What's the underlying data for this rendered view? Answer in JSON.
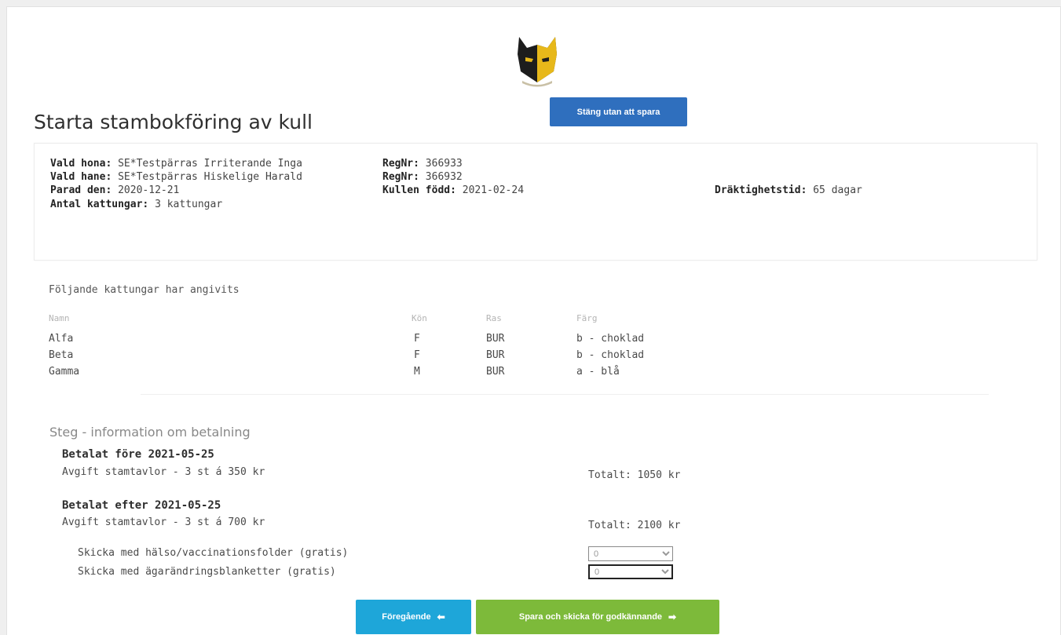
{
  "header": {
    "title": "Starta stambokföring av kull",
    "close_button": "Stäng utan att spara"
  },
  "litter": {
    "mother_label": "Vald hona:",
    "mother_value": "SE*Testpärras Irriterande Inga",
    "mother_reg_label": "RegNr:",
    "mother_reg_value": "366933",
    "father_label": "Vald hane:",
    "father_value": "SE*Testpärras Hiskelige Harald",
    "father_reg_label": "RegNr:",
    "father_reg_value": "366932",
    "mated_label": "Parad den:",
    "mated_value": "2020-12-21",
    "born_label": "Kullen född:",
    "born_value": "2021-02-24",
    "gestation_label": "Dräktighetstid:",
    "gestation_value": "65 dagar",
    "count_label": "Antal kattungar:",
    "count_value": "3 kattungar"
  },
  "kittens": {
    "section_label": "Följande kattungar har angivits",
    "columns": [
      "Namn",
      "Kön",
      "Ras",
      "Färg"
    ],
    "rows": [
      [
        "Alfa",
        "F",
        "BUR",
        "b - choklad"
      ],
      [
        "Beta",
        "F",
        "BUR",
        "b - choklad"
      ],
      [
        "Gamma",
        "M",
        "BUR",
        "a - blå"
      ]
    ]
  },
  "payment": {
    "step_title": "Steg - information om betalning",
    "before": {
      "heading": "Betalat före 2021-05-25",
      "fee": "Avgift stamtavlor - 3 st á 350 kr",
      "total": "Totalt: 1050 kr"
    },
    "after": {
      "heading": "Betalat efter 2021-05-25",
      "fee": "Avgift stamtavlor - 3 st á 700 kr",
      "total": "Totalt: 2100 kr"
    },
    "options": [
      {
        "label": "Skicka med hälso/vaccinationsfolder (gratis)",
        "value": "0"
      },
      {
        "label": "Skicka med ägarändringsblanketter (gratis)",
        "value": "0"
      }
    ]
  },
  "footer": {
    "prev_button": "Föregående",
    "submit_button": "Spara och skicka för godkännande"
  },
  "icons": {
    "logo": "cat-head-logo",
    "prev_arrow": "arrow-left-icon",
    "next_arrow": "arrow-right-icon"
  },
  "colors": {
    "close_button": "#2f6fbe",
    "prev_button": "#1ea6d9",
    "submit_button": "#7dba3a"
  }
}
